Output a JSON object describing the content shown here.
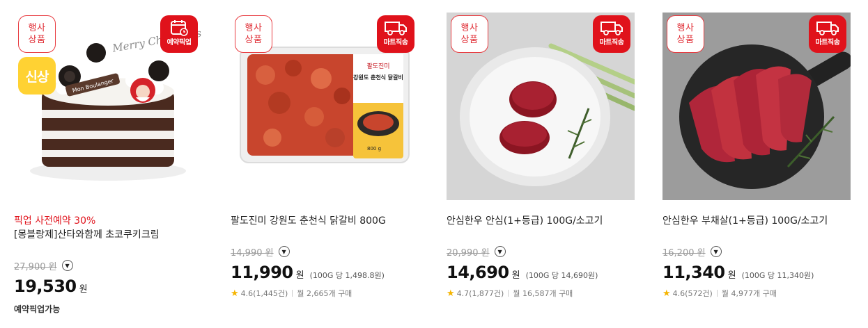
{
  "products": [
    {
      "event_badge": [
        "행사",
        "상품"
      ],
      "service_badge": {
        "label": "예약픽업",
        "icon": "calendar-icon"
      },
      "fresh_badge": "신상",
      "promo": "픽업 사전예약 30%",
      "name": "[몽블랑제]산타와함께 초코쿠키크림",
      "original_price": "27,900 원",
      "price": "19,530",
      "price_suffix": "원",
      "pickup_label": "예약픽업가능",
      "image_text": {
        "script": "Merry Christmas",
        "brand": "Mon Boulanger"
      }
    },
    {
      "event_badge": [
        "행사",
        "상품"
      ],
      "service_badge": {
        "label": "마트직송",
        "icon": "truck-icon"
      },
      "name": "팔도진미 강원도 춘천식 닭갈비 800G",
      "original_price": "14,990 원",
      "price": "11,990",
      "price_suffix": "원",
      "unit_price": "(100G 당 1,498.8원)",
      "rating": "4.6(1,445건)",
      "monthly_purchases": "월 2,665개 구매",
      "image_text": {
        "brand": "팔도진미",
        "title": "강원도 춘천식 닭갈비",
        "weight": "800 g"
      }
    },
    {
      "event_badge": [
        "행사",
        "상품"
      ],
      "service_badge": {
        "label": "마트직송",
        "icon": "truck-icon"
      },
      "name": "안심한우 안심(1+등급) 100G/소고기",
      "original_price": "20,990 원",
      "price": "14,690",
      "price_suffix": "원",
      "unit_price": "(100G 당 14,690원)",
      "rating": "4.7(1,877건)",
      "monthly_purchases": "월 16,587개 구매"
    },
    {
      "event_badge": [
        "행사",
        "상품"
      ],
      "service_badge": {
        "label": "마트직송",
        "icon": "truck-icon"
      },
      "name": "안심한우 부채살(1+등급) 100G/소고기",
      "original_price": "16,200 원",
      "price": "11,340",
      "price_suffix": "원",
      "unit_price": "(100G 당 11,340원)",
      "rating": "4.6(572건)",
      "monthly_purchases": "월 4,977개 구매"
    }
  ],
  "icons": {
    "info_toggle": "chevron-down-icon",
    "rating": "star-icon"
  },
  "colors": {
    "brand_red": "#e0121b",
    "fresh_yellow": "#ffd233",
    "star": "#f5b400"
  }
}
